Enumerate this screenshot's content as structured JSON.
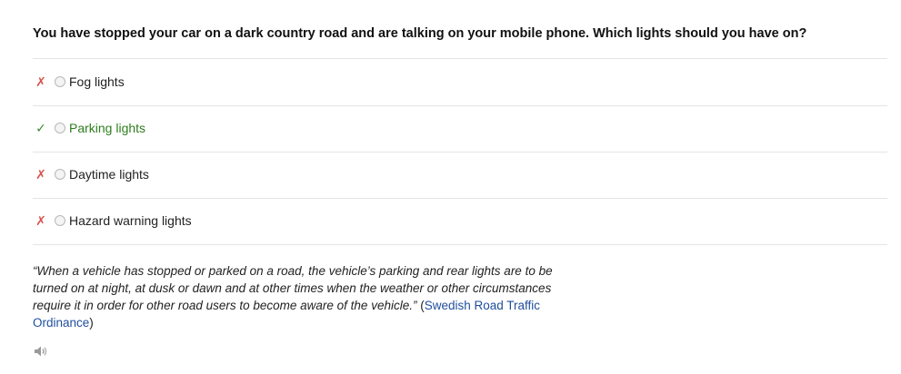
{
  "question": {
    "text": "You have stopped your car on a dark country road and are talking on your mobile phone. Which lights should you have on?"
  },
  "options": [
    {
      "label": "Fog lights",
      "mark": "✗",
      "correct": false
    },
    {
      "label": "Parking lights",
      "mark": "✓",
      "correct": true
    },
    {
      "label": "Daytime lights",
      "mark": "✗",
      "correct": false
    },
    {
      "label": "Hazard warning lights",
      "mark": "✗",
      "correct": false
    }
  ],
  "explanation": {
    "quote": "“When a vehicle has stopped or parked on a road, the vehicle’s parking and rear lights are to be turned on at night, at dusk or dawn and at other times when the weather or other circumstances require it in order for other road users to become aware of the vehicle.”",
    "source_open": " (",
    "source_link": "Swedish Road Traffic Ordinance",
    "source_close": ")"
  },
  "audio": {
    "icon": "speaker-icon"
  },
  "colors": {
    "wrong": "#d9534f",
    "correct": "#2e7d1e",
    "link": "#1f4e9c"
  }
}
